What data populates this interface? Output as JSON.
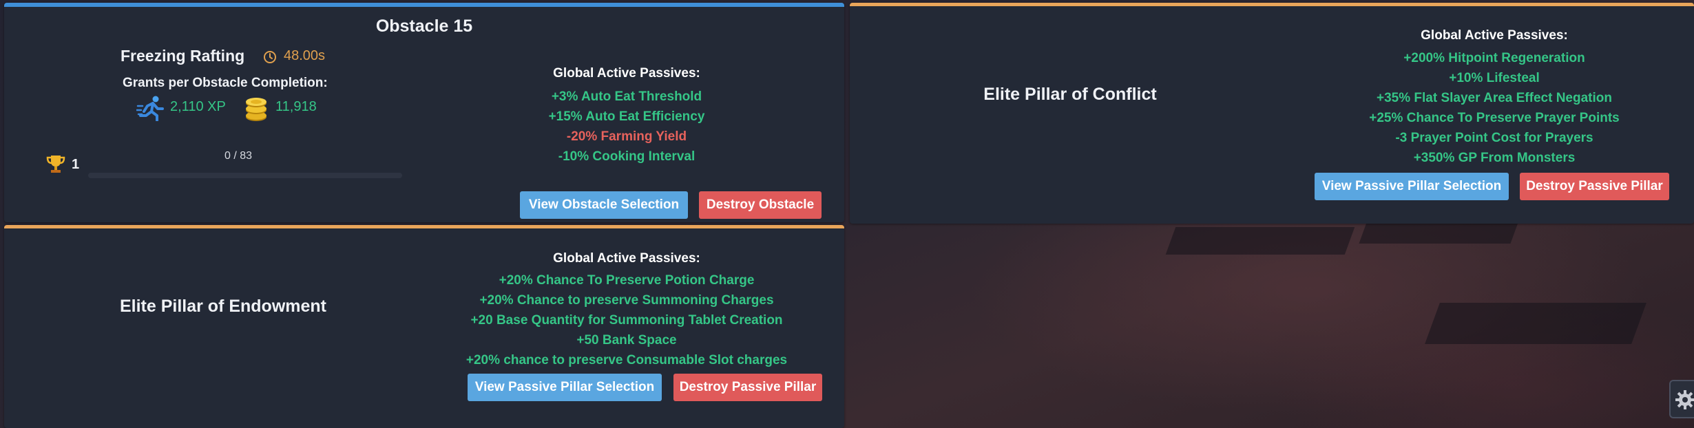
{
  "obstacle_card": {
    "header": "Obstacle 15",
    "name": "Freezing Rafting",
    "time": "48.00s",
    "grants_label": "Grants per Obstacle Completion:",
    "xp": "2,110 XP",
    "gp": "11,918",
    "mastery_level": "1",
    "progress_text": "0 / 83",
    "progress_fraction": 0,
    "passives_title": "Global Active Passives:",
    "passives": [
      {
        "text": "+3% Auto Eat Threshold",
        "type": "positive"
      },
      {
        "text": "+15% Auto Eat Efficiency",
        "type": "positive"
      },
      {
        "text": "-20% Farming Yield",
        "type": "negative"
      },
      {
        "text": "-10% Cooking Interval",
        "type": "positive"
      }
    ],
    "view_button": "View Obstacle Selection",
    "destroy_button": "Destroy Obstacle"
  },
  "endowment_card": {
    "name": "Elite Pillar of Endowment",
    "passives_title": "Global Active Passives:",
    "passives": [
      {
        "text": "+20% Chance To Preserve Potion Charge",
        "type": "positive"
      },
      {
        "text": "+20% Chance to preserve Summoning Charges",
        "type": "positive"
      },
      {
        "text": "+20 Base Quantity for Summoning Tablet Creation",
        "type": "positive"
      },
      {
        "text": "+50 Bank Space",
        "type": "positive"
      },
      {
        "text": "+20% chance to preserve Consumable Slot charges",
        "type": "positive"
      }
    ],
    "view_button": "View Passive Pillar Selection",
    "destroy_button": "Destroy Passive Pillar"
  },
  "conflict_card": {
    "name": "Elite Pillar of Conflict",
    "passives_title": "Global Active Passives:",
    "passives": [
      {
        "text": "+200% Hitpoint Regeneration",
        "type": "positive"
      },
      {
        "text": "+10% Lifesteal",
        "type": "positive"
      },
      {
        "text": "+35% Flat Slayer Area Effect Negation",
        "type": "positive"
      },
      {
        "text": "+25% Chance To Preserve Prayer Points",
        "type": "positive"
      },
      {
        "text": "-3 Prayer Point Cost for Prayers",
        "type": "positive"
      },
      {
        "text": "+350% GP From Monsters",
        "type": "positive"
      }
    ],
    "view_button": "View Passive Pillar Selection",
    "destroy_button": "Destroy Passive Pillar"
  },
  "colors": {
    "positive": "#35c687",
    "negative": "#e7625c",
    "accent_blue": "#3f8fd8",
    "accent_orange": "#e9a55a",
    "time": "#e0a04e"
  },
  "icons": [
    "clock-icon",
    "running-man-icon",
    "coins-icon",
    "trophy-icon",
    "gear-icon"
  ]
}
